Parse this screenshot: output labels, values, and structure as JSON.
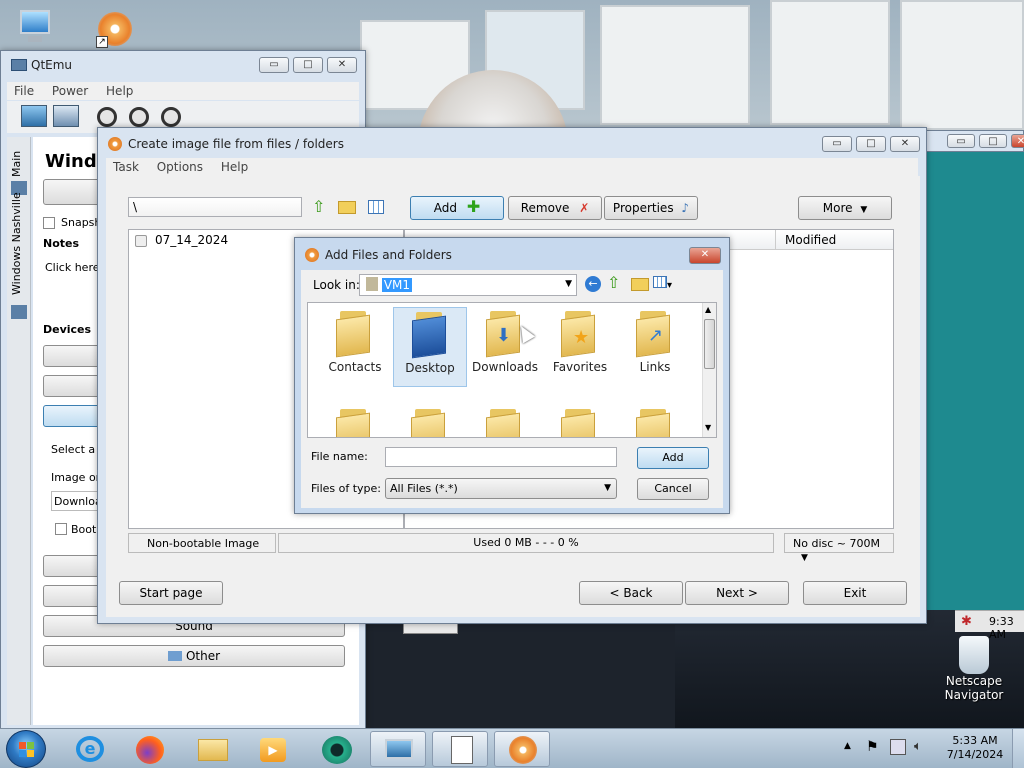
{
  "desktop": {
    "icons": [
      {
        "name": "computer-icon",
        "label": ""
      },
      {
        "name": "cd-shortcut-icon",
        "label": ""
      },
      {
        "name": "netscape-icon",
        "label": "Netscape Navigator"
      }
    ],
    "background_window_time": "9:33 AM"
  },
  "qtemu": {
    "title": "QtEmu",
    "menu": [
      "File",
      "Power",
      "Help"
    ],
    "side_tabs": [
      "Main",
      "Windows Nashville"
    ],
    "heading": "Windo",
    "snapshot_label": "Snapsh",
    "notes_label": "Notes",
    "notes_text": "Click here t",
    "devices_label": "Devices",
    "select_text": "Select a v",
    "image_text": "Image or",
    "downloads_text": "Downloads",
    "boot_text": "Boot",
    "sound_label": "Sound",
    "other_label": "Other"
  },
  "create_image": {
    "title": "Create image file from files / folders",
    "menu": [
      "Task",
      "Options",
      "Help"
    ],
    "path": "\\",
    "add_label": "Add",
    "remove_label": "Remove",
    "properties_label": "Properties",
    "more_label": "More",
    "tree_item": "07_14_2024",
    "column_modified": "Modified",
    "status_image": "Non-bootable Image",
    "status_used": "Used  0 MB   - - -  0 %",
    "status_disc": "No disc ~ 700M",
    "start_page": "Start page",
    "back": "< Back",
    "next": "Next >",
    "exit": "Exit"
  },
  "add_dialog": {
    "title": "Add Files and Folders",
    "look_in_label": "Look in:",
    "look_in_value": "VM1",
    "folders": [
      "Contacts",
      "Desktop",
      "Downloads",
      "Favorites",
      "Links"
    ],
    "file_name_label": "File name:",
    "file_name_value": "",
    "files_of_type_label": "Files of type:",
    "files_of_type_value": "All Files (*.*)",
    "add_label": "Add",
    "cancel_label": "Cancel"
  },
  "taskbar": {
    "time": "5:33 AM",
    "date": "7/14/2024"
  },
  "colors": {
    "accent": "#3c7fb1",
    "title_bar": "#d9e4f1",
    "close_red": "#c9452d"
  }
}
